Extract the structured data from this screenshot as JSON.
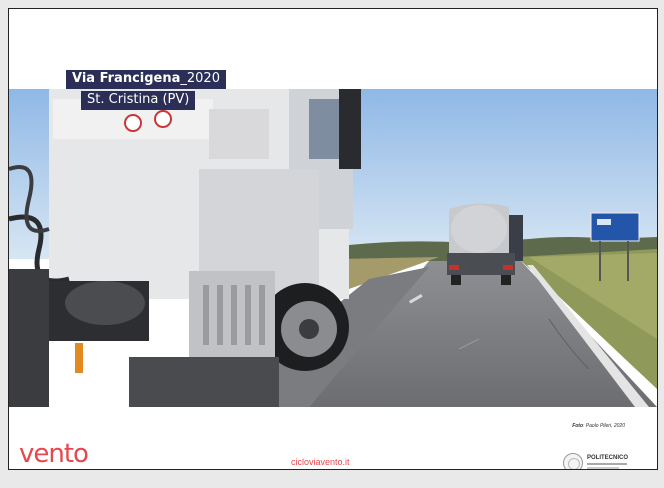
{
  "slide": {
    "title_bold": "Via Francigena",
    "title_year": "_2020",
    "subtitle": "St. Cristina (PV)",
    "credit_label": "Foto",
    "credit_text": ": Paolo Pileri, 2020",
    "footer_url": "cicloviavento.it"
  },
  "logos": {
    "vento": "vento",
    "polimi": "POLITECNICO"
  },
  "photo": {
    "description_icons": [
      "truck-cab",
      "tanker-truck",
      "road-sign",
      "road",
      "sky"
    ],
    "sign_label": "0"
  },
  "colors": {
    "title_bg": "#2b2f57",
    "brand_red": "#e5484d"
  }
}
